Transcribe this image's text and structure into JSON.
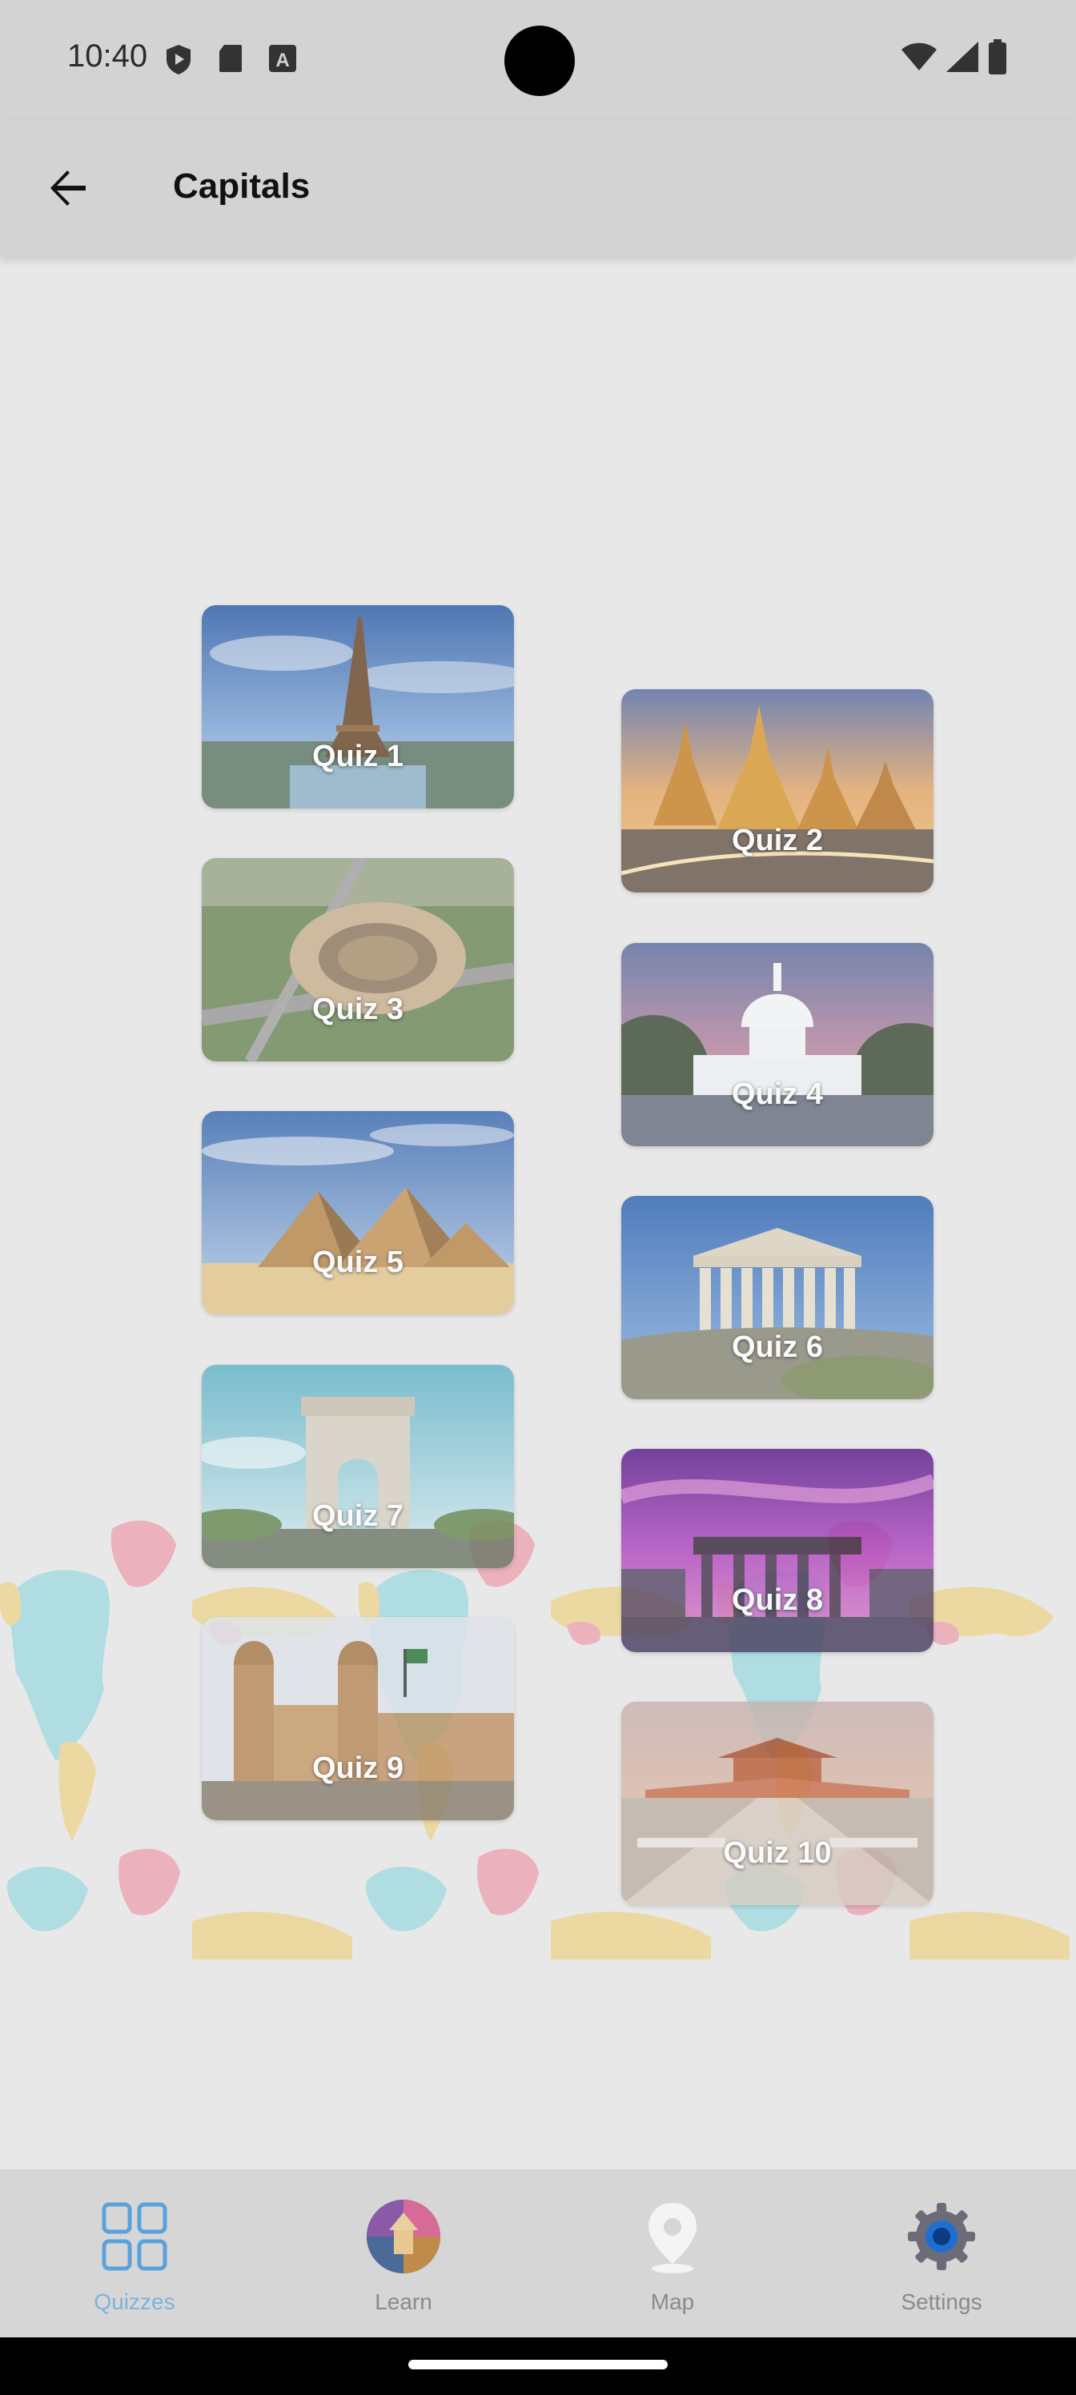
{
  "status_bar": {
    "time": "10:40"
  },
  "app_bar": {
    "title": "Capitals"
  },
  "quizzes": [
    {
      "label": "Quiz 1",
      "theme": "eiffel-tower"
    },
    {
      "label": "Quiz 2",
      "theme": "grand-palace"
    },
    {
      "label": "Quiz 3",
      "theme": "colosseum"
    },
    {
      "label": "Quiz 4",
      "theme": "capitol"
    },
    {
      "label": "Quiz 5",
      "theme": "pyramids"
    },
    {
      "label": "Quiz 6",
      "theme": "parthenon"
    },
    {
      "label": "Quiz 7",
      "theme": "arc-de-triomphe"
    },
    {
      "label": "Quiz 8",
      "theme": "brandenburg-gate"
    },
    {
      "label": "Quiz 9",
      "theme": "cathedral"
    },
    {
      "label": "Quiz 10",
      "theme": "forbidden-city"
    }
  ],
  "bottom_nav": {
    "items": [
      {
        "label": "Quizzes",
        "icon": "grid-icon",
        "active": true
      },
      {
        "label": "Learn",
        "icon": "learn-icon",
        "active": false
      },
      {
        "label": "Map",
        "icon": "map-pin-icon",
        "active": false
      },
      {
        "label": "Settings",
        "icon": "gear-icon",
        "active": false
      }
    ]
  },
  "colors": {
    "active_nav": "#7cb3dc",
    "inactive_nav": "#8a8a8a",
    "app_bar": "#d3d3d3",
    "background": "#e8e8e8"
  }
}
